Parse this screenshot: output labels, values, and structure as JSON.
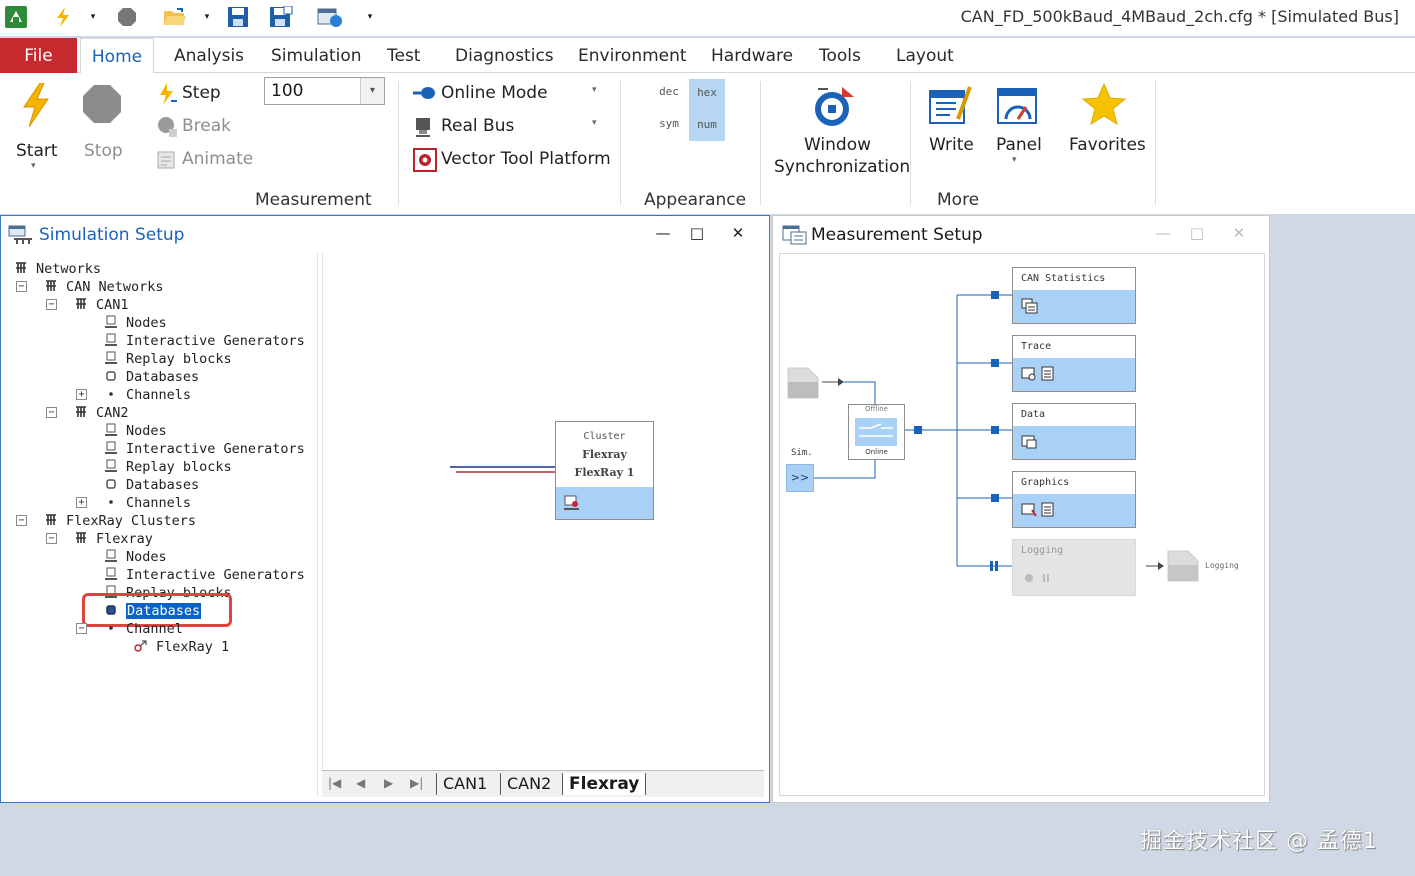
{
  "window": {
    "title": "CAN_FD_500kBaud_4MBaud_2ch.cfg * [Simulated Bus]"
  },
  "menu": {
    "tabs": [
      "File",
      "Home",
      "Analysis",
      "Simulation",
      "Test",
      "Diagnostics",
      "Environment",
      "Hardware",
      "Tools",
      "Layout"
    ],
    "active": "Home"
  },
  "ribbon": {
    "start": "Start",
    "stop": "Stop",
    "step": "Step",
    "break": "Break",
    "animate": "Animate",
    "step_value": "100",
    "online_mode": "Online Mode",
    "real_bus": "Real Bus",
    "vector_tool_platform": "Vector Tool Platform",
    "group_measurement": "Measurement",
    "dec": "dec",
    "hex": "hex",
    "sym": "sym",
    "num": "num",
    "group_appearance": "Appearance",
    "window_sync_line1": "Window",
    "window_sync_line2": "Synchronization",
    "write": "Write",
    "panel": "Panel",
    "favorites": "Favorites",
    "group_more": "More"
  },
  "simulation_setup": {
    "title": "Simulation Setup",
    "tree": {
      "networks": "Networks",
      "can_networks": "CAN Networks",
      "can1": "CAN1",
      "can2": "CAN2",
      "nodes": "Nodes",
      "interactive_generators": "Interactive Generators",
      "replay_blocks": "Replay blocks",
      "databases": "Databases",
      "channels": "Channels",
      "flexray_clusters": "FlexRay Clusters",
      "flexray": "Flexray",
      "channel": "Channel",
      "flexray1": "FlexRay 1"
    },
    "cluster_box": {
      "label": "Cluster",
      "name": "Flexray",
      "channel": "FlexRay 1"
    },
    "sheet_tabs": [
      "CAN1",
      "CAN2",
      "Flexray"
    ],
    "active_sheet": "Flexray"
  },
  "measurement_setup": {
    "title": "Measurement Setup",
    "blocks": [
      "CAN Statistics",
      "Trace",
      "Data",
      "Graphics",
      "Logging"
    ],
    "switch_offline": "Offline",
    "switch_online": "Online",
    "sim_label": "Sim.",
    "sim_button": ">>",
    "logging_output": "Logging"
  },
  "watermark": "掘金技术社区 @ 孟德1",
  "colors": {
    "file_tab": "#c62a2f",
    "accent_blue": "#1a62b8",
    "block_fill": "#a9d0f5",
    "highlight": "#0a63c9",
    "callout": "#e0443f"
  }
}
